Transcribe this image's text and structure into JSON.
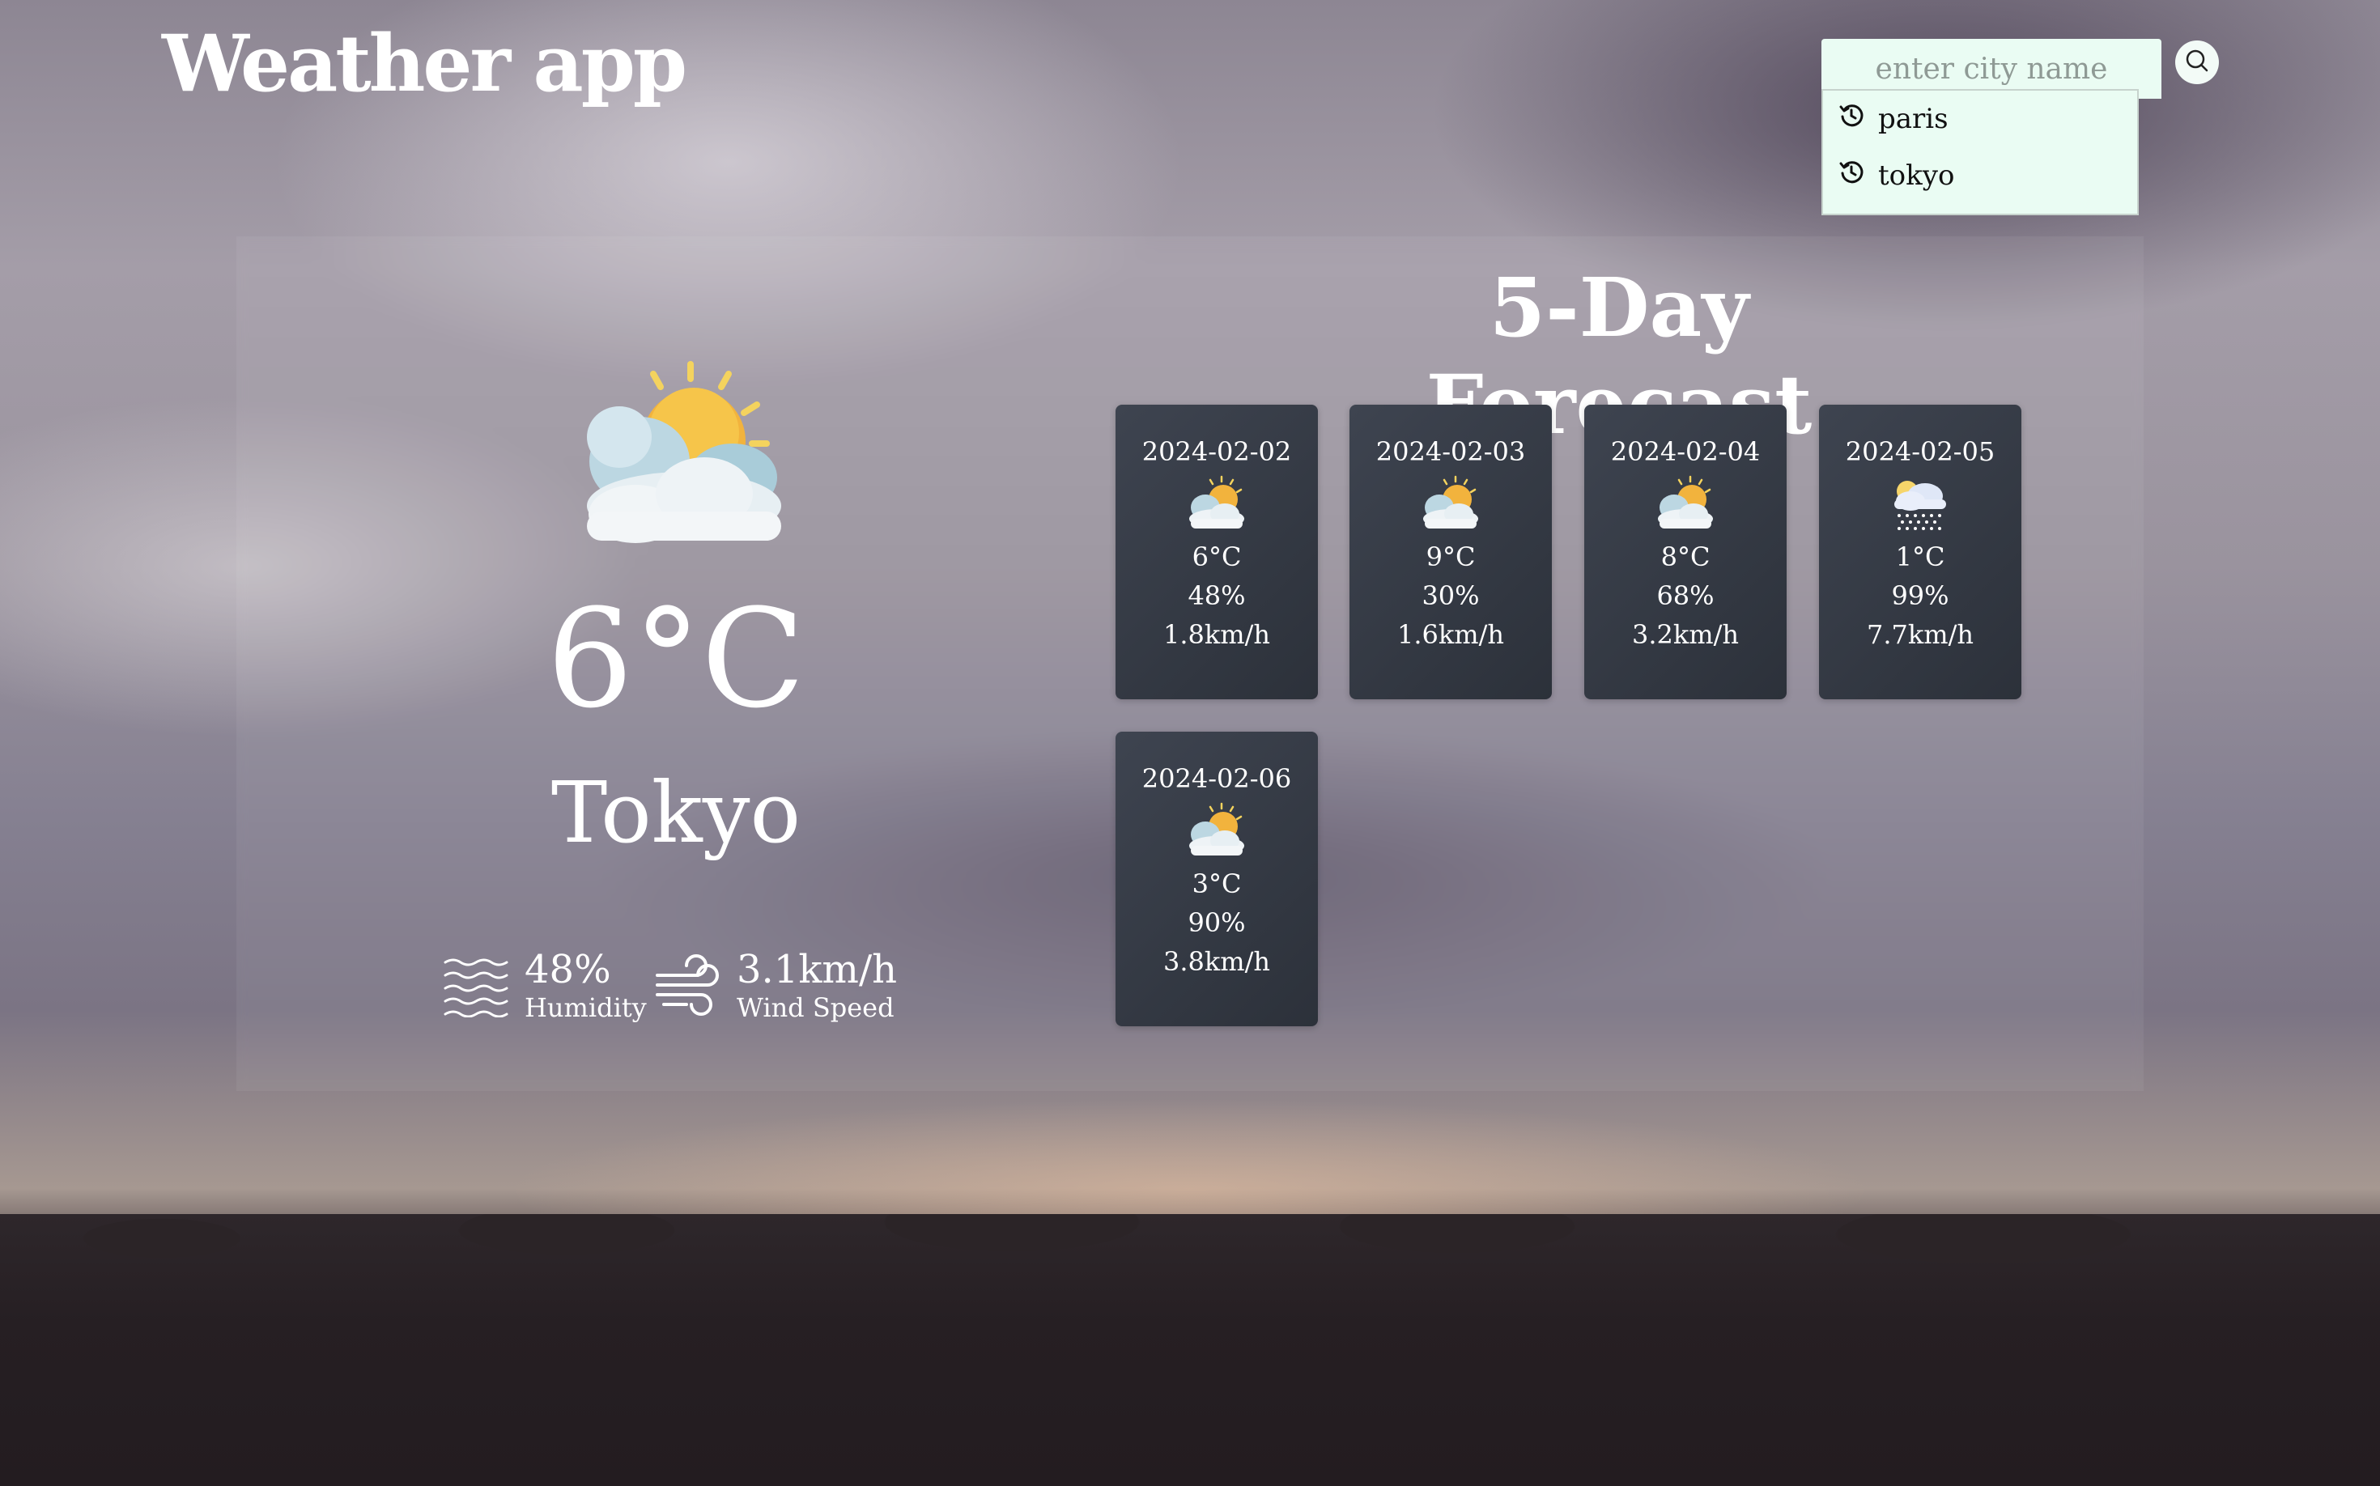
{
  "app": {
    "title": "Weather app"
  },
  "search": {
    "placeholder": "enter city name",
    "history": [
      {
        "label": "paris"
      },
      {
        "label": "tokyo"
      }
    ]
  },
  "current": {
    "icon": "partly-cloudy-icon",
    "temperature": "6°C",
    "city": "Tokyo",
    "humidity": {
      "value": "48%",
      "label": "Humidity",
      "icon": "humidity-icon"
    },
    "wind": {
      "value": "3.1km/h",
      "label": "Wind Speed",
      "icon": "wind-icon"
    }
  },
  "forecast": {
    "heading": "5-Day Forecast",
    "days": [
      {
        "date": "2024-02-02",
        "icon": "partly-cloudy-icon",
        "temp": "6°C",
        "humidity": "48%",
        "wind": "1.8km/h"
      },
      {
        "date": "2024-02-03",
        "icon": "partly-cloudy-icon",
        "temp": "9°C",
        "humidity": "30%",
        "wind": "1.6km/h"
      },
      {
        "date": "2024-02-04",
        "icon": "partly-cloudy-icon",
        "temp": "8°C",
        "humidity": "68%",
        "wind": "3.2km/h"
      },
      {
        "date": "2024-02-05",
        "icon": "snow-icon",
        "temp": "1°C",
        "humidity": "99%",
        "wind": "7.7km/h"
      },
      {
        "date": "2024-02-06",
        "icon": "partly-cloudy-icon",
        "temp": "3°C",
        "humidity": "90%",
        "wind": "3.8km/h"
      }
    ]
  },
  "colors": {
    "search_bg": "#eafcf3",
    "card_bg": "#343a44",
    "sun": "#f2b33d",
    "cloud": "#cfe2ea"
  }
}
